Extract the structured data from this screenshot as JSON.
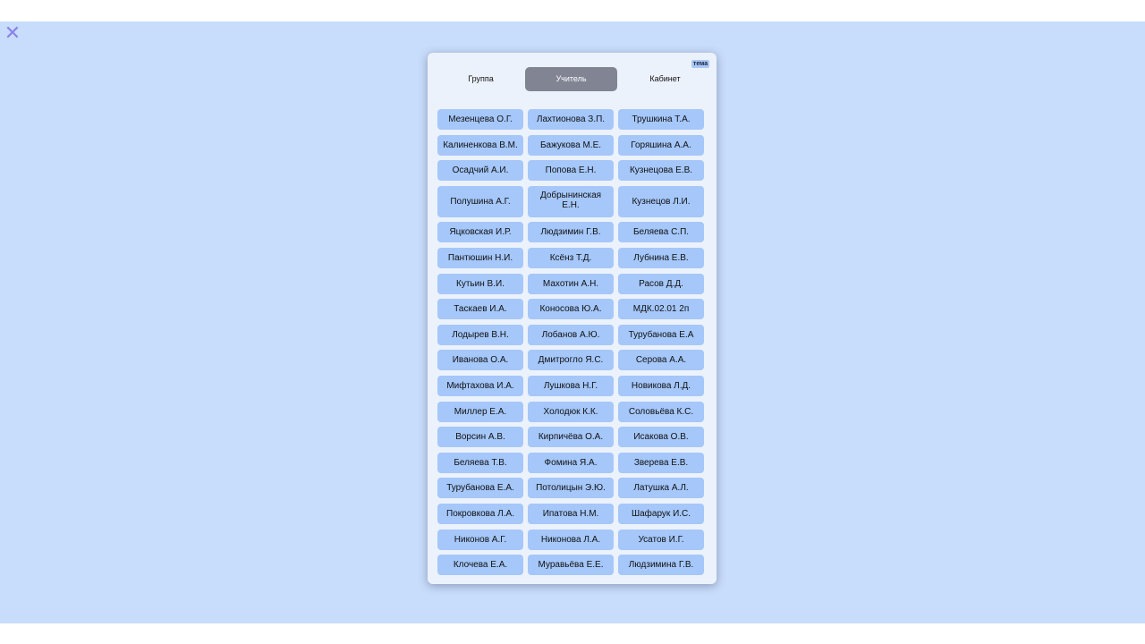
{
  "colors": {
    "backdrop": "#c8dcfb",
    "panel": "#ecf2fb",
    "cell": "#a5c7fa",
    "active_tab": "#818593",
    "close_icon": "#8a82e8"
  },
  "close_icon": "close-icon",
  "theme_label": "тема",
  "tabs": [
    {
      "label": "Группа",
      "active": false
    },
    {
      "label": "Учитель",
      "active": true
    },
    {
      "label": "Кабинет",
      "active": false
    }
  ],
  "teachers": [
    "Мезенцева О.Г.",
    "Лахтионова З.П.",
    "Трушкина Т.А.",
    "Калиненкова В.М.",
    "Бажукова М.Е.",
    "Горяшина А.А.",
    "Осадчий А.И.",
    "Попова Е.Н.",
    "Кузнецова Е.В.",
    "Полушина А.Г.",
    "Добрынинская Е.Н.",
    "Кузнецов Л.И.",
    "Яцковская И.Р.",
    "Людзимин Г.В.",
    "Беляева С.П.",
    "Пантюшин Н.И.",
    "Ксёнз Т.Д.",
    "Лубнина Е.В.",
    "Кутьин В.И.",
    "Махотин А.Н.",
    "Расов Д.Д.",
    "Таскаев И.А.",
    "Коносова Ю.А.",
    "МДК.02.01 2п",
    "Лодырев В.Н.",
    "Лобанов А.Ю.",
    "Турубанова Е.А",
    "Иванова О.А.",
    "Дмитрогло Я.С.",
    "Серова А.А.",
    "Мифтахова И.А.",
    "Лушкова Н.Г.",
    "Новикова Л.Д.",
    "Миллер Е.А.",
    "Холодюк К.К.",
    "Соловьёва К.С.",
    "Ворсин А.В.",
    "Кирпичёва О.А.",
    "Исакова О.В.",
    "Беляева Т.В.",
    "Фомина Я.А.",
    "Зверева Е.В.",
    "Турубанова Е.А.",
    "Потолицын Э.Ю.",
    "Латушка А.Л.",
    "Покровкова Л.А.",
    "Ипатова Н.М.",
    "Шафарук И.С.",
    "Никонов А.Г.",
    "Никонова Л.А.",
    "Усатов И.Г.",
    "Клочева Е.А.",
    "Муравьёва Е.Е.",
    "Людзимина Г.В."
  ]
}
